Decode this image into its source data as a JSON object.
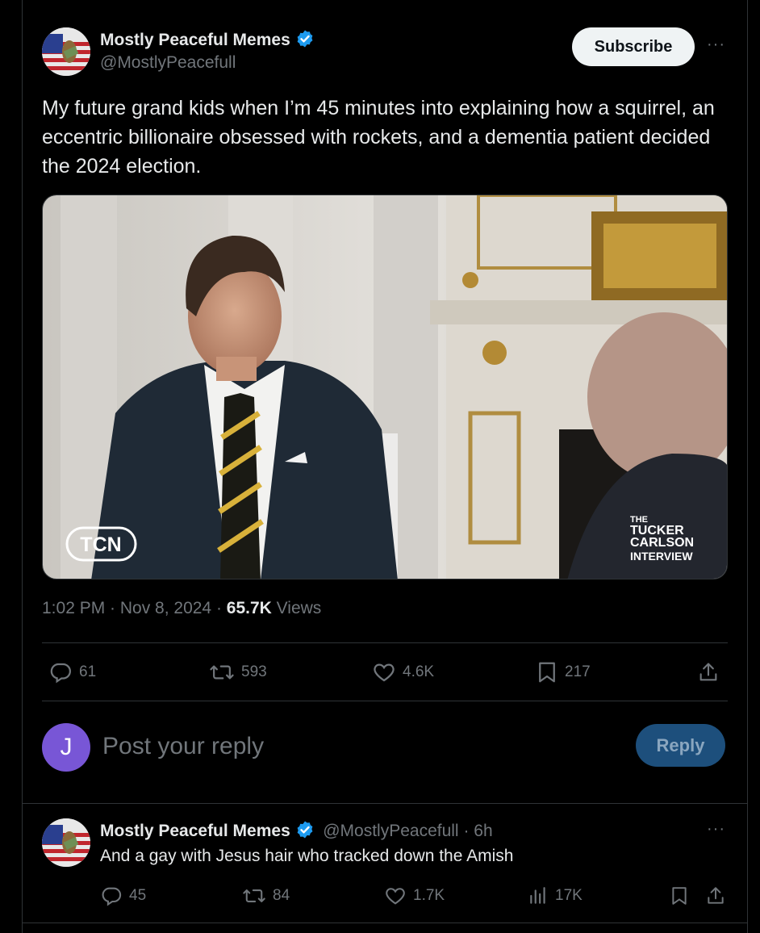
{
  "tweet": {
    "author_name": "Mostly Peaceful Memes",
    "author_handle": "@MostlyPeacefull",
    "subscribe_label": "Subscribe",
    "more_label": "···",
    "text": "My future grand kids when I’m 45 minutes into explaining how a squirrel, an eccentric billionaire obsessed with rockets, and a dementia patient decided the 2024 election.",
    "media": {
      "logo_left": "TCN",
      "logo_right": [
        "THE",
        "TUCKER",
        "CARLSON",
        "INTERVIEW"
      ]
    },
    "time": "1:02 PM · Nov 8, 2024 · ",
    "views_count": "65.7K",
    "views_label": " Views",
    "stats": {
      "replies": "61",
      "reposts": "593",
      "likes": "4.6K",
      "bookmarks": "217"
    }
  },
  "composer": {
    "avatar_letter": "J",
    "placeholder": "Post your reply",
    "reply_label": "Reply"
  },
  "reply": {
    "author_name": "Mostly Peaceful Memes",
    "author_handle": "@MostlyPeacefull",
    "time": " · 6h",
    "more_label": "···",
    "text": "And a gay with Jesus hair who tracked down the Amish",
    "stats": {
      "replies": "45",
      "reposts": "84",
      "likes": "1.7K",
      "views": "17K"
    }
  },
  "colors": {
    "background": "#000000",
    "text": "#e7e9ea",
    "muted": "#71767b",
    "border": "#2f3336",
    "verified": "#1d9bf0",
    "reply_button": "#1d4f7c",
    "composer_avatar": "#7856d6"
  },
  "icons": [
    "verified-badge-icon",
    "comment-icon",
    "repost-icon",
    "heart-icon",
    "bookmark-icon",
    "share-icon",
    "views-icon"
  ]
}
